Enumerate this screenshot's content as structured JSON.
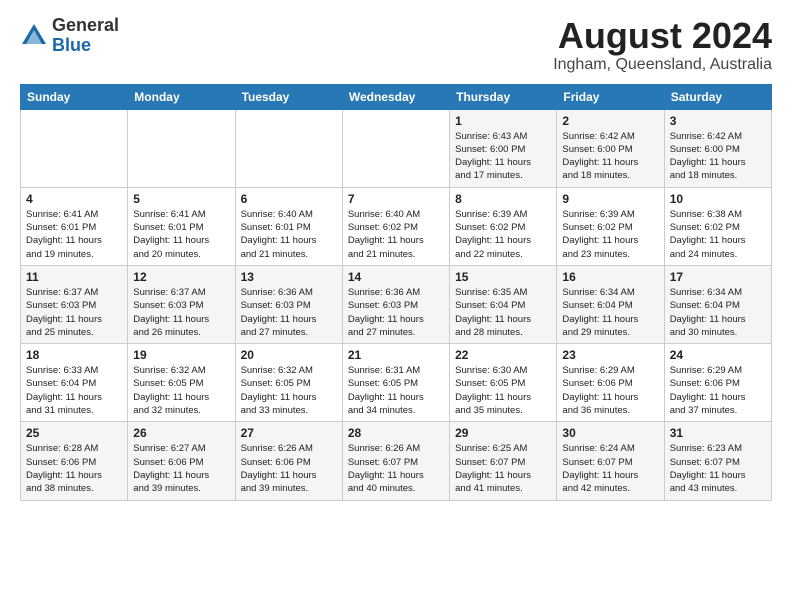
{
  "header": {
    "logo_general": "General",
    "logo_blue": "Blue",
    "month_year": "August 2024",
    "location": "Ingham, Queensland, Australia"
  },
  "weekdays": [
    "Sunday",
    "Monday",
    "Tuesday",
    "Wednesday",
    "Thursday",
    "Friday",
    "Saturday"
  ],
  "weeks": [
    [
      {
        "day": "",
        "info": ""
      },
      {
        "day": "",
        "info": ""
      },
      {
        "day": "",
        "info": ""
      },
      {
        "day": "",
        "info": ""
      },
      {
        "day": "1",
        "info": "Sunrise: 6:43 AM\nSunset: 6:00 PM\nDaylight: 11 hours\nand 17 minutes."
      },
      {
        "day": "2",
        "info": "Sunrise: 6:42 AM\nSunset: 6:00 PM\nDaylight: 11 hours\nand 18 minutes."
      },
      {
        "day": "3",
        "info": "Sunrise: 6:42 AM\nSunset: 6:00 PM\nDaylight: 11 hours\nand 18 minutes."
      }
    ],
    [
      {
        "day": "4",
        "info": "Sunrise: 6:41 AM\nSunset: 6:01 PM\nDaylight: 11 hours\nand 19 minutes."
      },
      {
        "day": "5",
        "info": "Sunrise: 6:41 AM\nSunset: 6:01 PM\nDaylight: 11 hours\nand 20 minutes."
      },
      {
        "day": "6",
        "info": "Sunrise: 6:40 AM\nSunset: 6:01 PM\nDaylight: 11 hours\nand 21 minutes."
      },
      {
        "day": "7",
        "info": "Sunrise: 6:40 AM\nSunset: 6:02 PM\nDaylight: 11 hours\nand 21 minutes."
      },
      {
        "day": "8",
        "info": "Sunrise: 6:39 AM\nSunset: 6:02 PM\nDaylight: 11 hours\nand 22 minutes."
      },
      {
        "day": "9",
        "info": "Sunrise: 6:39 AM\nSunset: 6:02 PM\nDaylight: 11 hours\nand 23 minutes."
      },
      {
        "day": "10",
        "info": "Sunrise: 6:38 AM\nSunset: 6:02 PM\nDaylight: 11 hours\nand 24 minutes."
      }
    ],
    [
      {
        "day": "11",
        "info": "Sunrise: 6:37 AM\nSunset: 6:03 PM\nDaylight: 11 hours\nand 25 minutes."
      },
      {
        "day": "12",
        "info": "Sunrise: 6:37 AM\nSunset: 6:03 PM\nDaylight: 11 hours\nand 26 minutes."
      },
      {
        "day": "13",
        "info": "Sunrise: 6:36 AM\nSunset: 6:03 PM\nDaylight: 11 hours\nand 27 minutes."
      },
      {
        "day": "14",
        "info": "Sunrise: 6:36 AM\nSunset: 6:03 PM\nDaylight: 11 hours\nand 27 minutes."
      },
      {
        "day": "15",
        "info": "Sunrise: 6:35 AM\nSunset: 6:04 PM\nDaylight: 11 hours\nand 28 minutes."
      },
      {
        "day": "16",
        "info": "Sunrise: 6:34 AM\nSunset: 6:04 PM\nDaylight: 11 hours\nand 29 minutes."
      },
      {
        "day": "17",
        "info": "Sunrise: 6:34 AM\nSunset: 6:04 PM\nDaylight: 11 hours\nand 30 minutes."
      }
    ],
    [
      {
        "day": "18",
        "info": "Sunrise: 6:33 AM\nSunset: 6:04 PM\nDaylight: 11 hours\nand 31 minutes."
      },
      {
        "day": "19",
        "info": "Sunrise: 6:32 AM\nSunset: 6:05 PM\nDaylight: 11 hours\nand 32 minutes."
      },
      {
        "day": "20",
        "info": "Sunrise: 6:32 AM\nSunset: 6:05 PM\nDaylight: 11 hours\nand 33 minutes."
      },
      {
        "day": "21",
        "info": "Sunrise: 6:31 AM\nSunset: 6:05 PM\nDaylight: 11 hours\nand 34 minutes."
      },
      {
        "day": "22",
        "info": "Sunrise: 6:30 AM\nSunset: 6:05 PM\nDaylight: 11 hours\nand 35 minutes."
      },
      {
        "day": "23",
        "info": "Sunrise: 6:29 AM\nSunset: 6:06 PM\nDaylight: 11 hours\nand 36 minutes."
      },
      {
        "day": "24",
        "info": "Sunrise: 6:29 AM\nSunset: 6:06 PM\nDaylight: 11 hours\nand 37 minutes."
      }
    ],
    [
      {
        "day": "25",
        "info": "Sunrise: 6:28 AM\nSunset: 6:06 PM\nDaylight: 11 hours\nand 38 minutes."
      },
      {
        "day": "26",
        "info": "Sunrise: 6:27 AM\nSunset: 6:06 PM\nDaylight: 11 hours\nand 39 minutes."
      },
      {
        "day": "27",
        "info": "Sunrise: 6:26 AM\nSunset: 6:06 PM\nDaylight: 11 hours\nand 39 minutes."
      },
      {
        "day": "28",
        "info": "Sunrise: 6:26 AM\nSunset: 6:07 PM\nDaylight: 11 hours\nand 40 minutes."
      },
      {
        "day": "29",
        "info": "Sunrise: 6:25 AM\nSunset: 6:07 PM\nDaylight: 11 hours\nand 41 minutes."
      },
      {
        "day": "30",
        "info": "Sunrise: 6:24 AM\nSunset: 6:07 PM\nDaylight: 11 hours\nand 42 minutes."
      },
      {
        "day": "31",
        "info": "Sunrise: 6:23 AM\nSunset: 6:07 PM\nDaylight: 11 hours\nand 43 minutes."
      }
    ]
  ]
}
